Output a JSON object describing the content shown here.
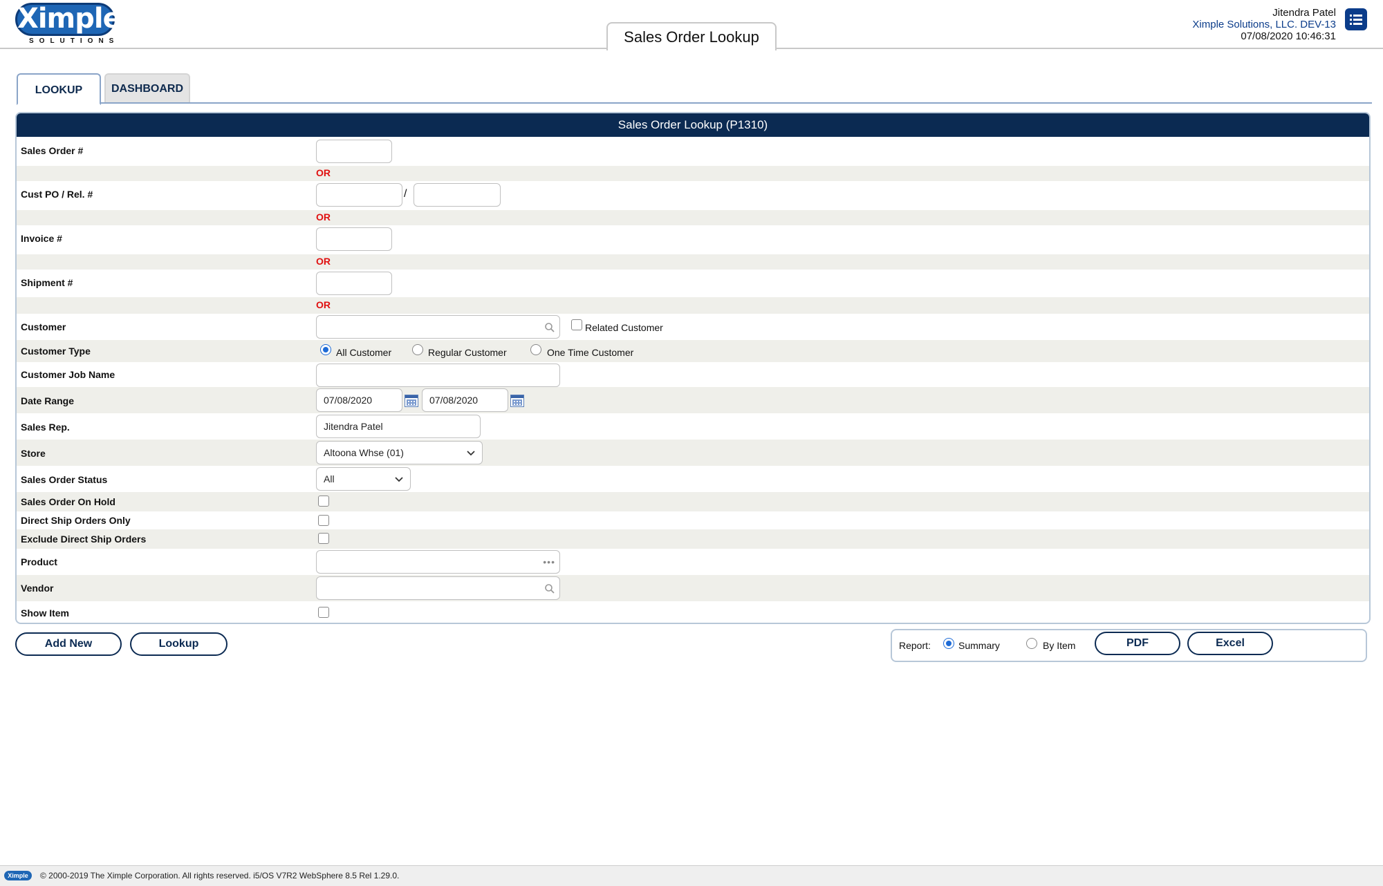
{
  "header": {
    "logo_text": "Ximple",
    "logo_sub": "SOLUTIONS",
    "page_tab": "Sales Order Lookup",
    "user_name": "Jitendra Patel",
    "company": "Ximple Solutions, LLC. DEV-13",
    "datetime": "07/08/2020 10:46:31",
    "menu_icon": "list-menu-icon"
  },
  "tabs": [
    {
      "label": "LOOKUP",
      "active": true
    },
    {
      "label": "DASHBOARD",
      "active": false
    }
  ],
  "form": {
    "title": "Sales Order Lookup (P1310)",
    "or_text": "OR",
    "sales_order_label": "Sales Order #",
    "sales_order_value": "",
    "cust_po_label": "Cust PO / Rel. #",
    "cust_po_value": "",
    "rel_value": "",
    "slash": "/",
    "invoice_label": "Invoice #",
    "invoice_value": "",
    "shipment_label": "Shipment #",
    "shipment_value": "",
    "customer_label": "Customer",
    "customer_value": "",
    "related_customer_label": "Related Customer",
    "related_customer_checked": false,
    "customer_type_label": "Customer Type",
    "customer_type_options": [
      "All Customer",
      "Regular Customer",
      "One Time Customer"
    ],
    "customer_type_selected": "All Customer",
    "job_name_label": "Customer Job Name",
    "job_name_value": "",
    "date_range_label": "Date Range",
    "date_from": "07/08/2020",
    "date_to": "07/08/2020",
    "sales_rep_label": "Sales Rep.",
    "sales_rep_value": "Jitendra  Patel",
    "store_label": "Store",
    "store_value": "Altoona Whse (01)",
    "status_label": "Sales Order Status",
    "status_value": "All",
    "on_hold_label": "Sales Order On Hold",
    "direct_ship_label": "Direct Ship Orders Only",
    "exclude_direct_label": "Exclude Direct Ship Orders",
    "product_label": "Product",
    "product_value": "",
    "vendor_label": "Vendor",
    "vendor_value": "",
    "show_item_label": "Show Item"
  },
  "actions": {
    "add_new": "Add New",
    "lookup": "Lookup",
    "report_label": "Report:",
    "report_options": [
      "Summary",
      "By Item"
    ],
    "report_selected": "Summary",
    "pdf": "PDF",
    "excel": "Excel"
  },
  "footer": {
    "logo_text": "Ximple",
    "text": "© 2000-2019 The Ximple Corporation. All rights reserved. i5/OS V7R2 WebSphere 8.5 Rel 1.29.0."
  }
}
